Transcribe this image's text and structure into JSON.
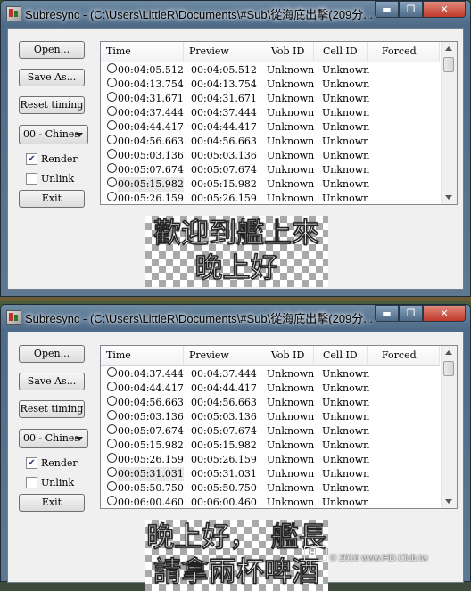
{
  "window_title": "Subresync - (C:\\Users\\LittleR\\Documents\\#Sub\\從海底出擊(209分...",
  "buttons": {
    "open": "Open...",
    "save_as": "Save As...",
    "reset_timing": "Reset timing",
    "exit": "Exit"
  },
  "language_select": "00 - Chines",
  "checkboxes": {
    "render": "Render",
    "unlink": "Unlink"
  },
  "window_controls": {
    "minimize": "▬",
    "maximize": "❐",
    "close": "✕"
  },
  "columns": [
    "Time",
    "Preview",
    "Vob ID",
    "Cell ID",
    "Forced"
  ],
  "window1": {
    "rows": [
      {
        "time": "00:04:05.512",
        "preview": "00:04:05.512",
        "vob": "Unknown",
        "cell": "Unknown"
      },
      {
        "time": "00:04:13.754",
        "preview": "00:04:13.754",
        "vob": "Unknown",
        "cell": "Unknown"
      },
      {
        "time": "00:04:31.671",
        "preview": "00:04:31.671",
        "vob": "Unknown",
        "cell": "Unknown"
      },
      {
        "time": "00:04:37.444",
        "preview": "00:04:37.444",
        "vob": "Unknown",
        "cell": "Unknown"
      },
      {
        "time": "00:04:44.417",
        "preview": "00:04:44.417",
        "vob": "Unknown",
        "cell": "Unknown"
      },
      {
        "time": "00:04:56.663",
        "preview": "00:04:56.663",
        "vob": "Unknown",
        "cell": "Unknown"
      },
      {
        "time": "00:05:03.136",
        "preview": "00:05:03.136",
        "vob": "Unknown",
        "cell": "Unknown"
      },
      {
        "time": "00:05:07.674",
        "preview": "00:05:07.674",
        "vob": "Unknown",
        "cell": "Unknown"
      },
      {
        "time": "00:05:15.982",
        "preview": "00:05:15.982",
        "vob": "Unknown",
        "cell": "Unknown"
      },
      {
        "time": "00:05:26.159",
        "preview": "00:05:26.159",
        "vob": "Unknown",
        "cell": "Unknown"
      }
    ],
    "subtitle": [
      "歡迎到艦上來",
      "晚上好"
    ],
    "render_checked": true,
    "unlink_checked": false
  },
  "window2": {
    "rows": [
      {
        "time": "00:04:37.444",
        "preview": "00:04:37.444",
        "vob": "Unknown",
        "cell": "Unknown"
      },
      {
        "time": "00:04:44.417",
        "preview": "00:04:44.417",
        "vob": "Unknown",
        "cell": "Unknown"
      },
      {
        "time": "00:04:56.663",
        "preview": "00:04:56.663",
        "vob": "Unknown",
        "cell": "Unknown"
      },
      {
        "time": "00:05:03.136",
        "preview": "00:05:03.136",
        "vob": "Unknown",
        "cell": "Unknown"
      },
      {
        "time": "00:05:07.674",
        "preview": "00:05:07.674",
        "vob": "Unknown",
        "cell": "Unknown"
      },
      {
        "time": "00:05:15.982",
        "preview": "00:05:15.982",
        "vob": "Unknown",
        "cell": "Unknown"
      },
      {
        "time": "00:05:26.159",
        "preview": "00:05:26.159",
        "vob": "Unknown",
        "cell": "Unknown"
      },
      {
        "time": "00:05:31.031",
        "preview": "00:05:31.031",
        "vob": "Unknown",
        "cell": "Unknown"
      },
      {
        "time": "00:05:50.750",
        "preview": "00:05:50.750",
        "vob": "Unknown",
        "cell": "Unknown"
      },
      {
        "time": "00:06:00.460",
        "preview": "00:06:00.460",
        "vob": "Unknown",
        "cell": "Unknown"
      }
    ],
    "subtitle": [
      "晚上好，　艦長",
      "請拿兩杯啤酒"
    ],
    "render_checked": true,
    "unlink_checked": false
  },
  "watermark": "© 2016  www.HD.Club.tw",
  "watermark_logo": "HD"
}
